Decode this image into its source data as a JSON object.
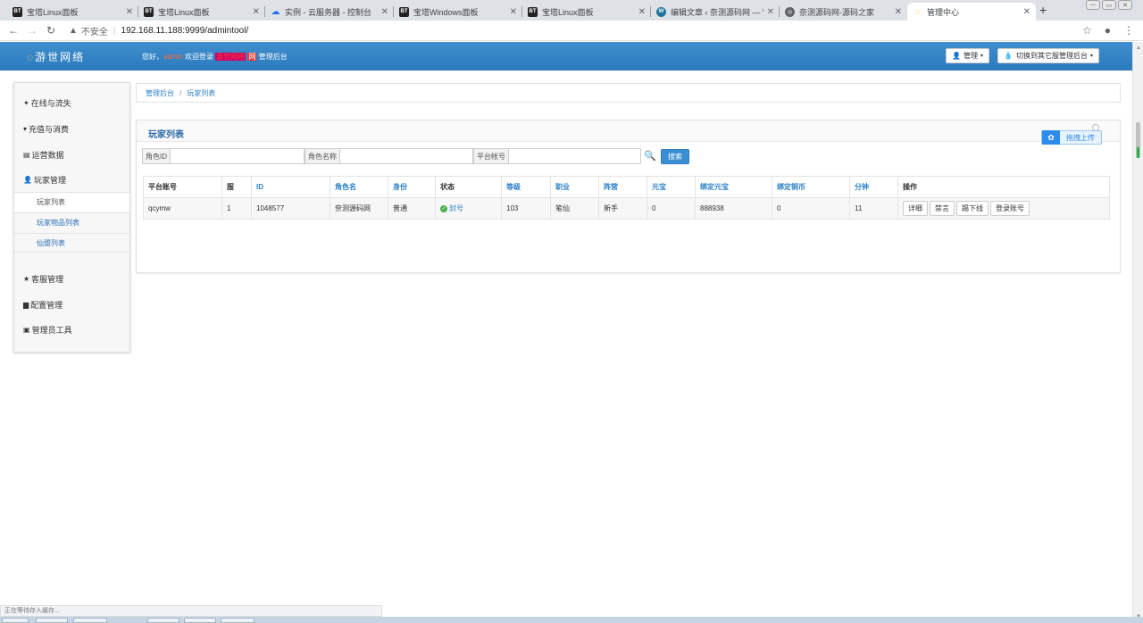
{
  "browser": {
    "tabs": [
      {
        "title": "宝塔Linux面板",
        "icon": "bt-icon",
        "fav": "BT"
      },
      {
        "title": "宝塔Linux面板",
        "icon": "bt-icon",
        "fav": "BT"
      },
      {
        "title": "实例 - 云服务器 - 控制台",
        "icon": "cloud-icon",
        "fav": "☁"
      },
      {
        "title": "宝塔Windows面板",
        "icon": "bt-icon",
        "fav": "BT"
      },
      {
        "title": "宝塔Linux面板",
        "icon": "bt-icon",
        "fav": "BT"
      },
      {
        "title": "编辑文章 ‹ 奈测源码网 — W",
        "icon": "wordpress-icon",
        "fav": "W"
      },
      {
        "title": "奈测源码网-源码之家",
        "icon": "globe-icon",
        "fav": "◎"
      },
      {
        "title": "管理中心",
        "icon": "leaf-icon",
        "fav": "◌"
      }
    ],
    "security_label": "不安全",
    "url": "192.168.11.188:9999/admintool/"
  },
  "header": {
    "logo": "游世网络",
    "welcome_prefix": "您好，",
    "username": "admin",
    "welcome_mid": " 欢迎登录 ",
    "site_name": "游世网络",
    "site_badge": "网",
    "welcome_suffix": "管理后台",
    "admin_btn": "管理",
    "switch_btn": "切换到其它服管理后台"
  },
  "sidebar": {
    "groups": [
      {
        "label": "在线与流失",
        "icon": "pin-icon",
        "glyph": "✦"
      },
      {
        "label": "充值与消费",
        "icon": "cart-icon",
        "glyph": "▾"
      },
      {
        "label": "运营数据",
        "icon": "list-icon",
        "glyph": "▤"
      },
      {
        "label": "玩家管理",
        "icon": "user-icon",
        "glyph": "👤"
      },
      {
        "label": "客服管理",
        "icon": "star-icon",
        "glyph": "★"
      },
      {
        "label": "配置管理",
        "icon": "book-icon",
        "glyph": "▆"
      },
      {
        "label": "管理员工具",
        "icon": "lock-icon",
        "glyph": "▣"
      }
    ],
    "sub_items": [
      {
        "label": "玩家列表"
      },
      {
        "label": "玩家物品列表"
      },
      {
        "label": "仙盟列表"
      }
    ]
  },
  "breadcrumb": {
    "home": "管理后台",
    "current": "玩家列表"
  },
  "panel": {
    "title": "玩家列表",
    "upload_label": "拖拽上传"
  },
  "search": {
    "role_id_label": "角色ID",
    "role_name_label": "角色名称",
    "platform_account_label": "平台帐号",
    "button": "搜索"
  },
  "table": {
    "columns": [
      "平台账号",
      "服",
      "ID",
      "角色名",
      "身份",
      "状态",
      "等级",
      "职业",
      "阵营",
      "元宝",
      "绑定元宝",
      "绑定铜币",
      "分钟",
      "操作"
    ],
    "rows": [
      {
        "account": "qcymw",
        "server": "1",
        "id": "1048577",
        "role_name": "奈测源码网",
        "identity": "普通",
        "status": "封号",
        "level": "103",
        "profession": "笔仙",
        "camp": "新手",
        "yuanbao": "0",
        "bound_yuanbao": "888938",
        "bound_copper": "0",
        "minutes": "11",
        "actions": [
          "详细",
          "禁言",
          "踢下线",
          "登录账号"
        ]
      }
    ]
  },
  "statusbar": {
    "text": "正在等待存入缓存..."
  },
  "colors": {
    "header_blue": "#2b7bbd",
    "link_blue": "#2a7fc8",
    "status_green": "#4cae4c"
  }
}
